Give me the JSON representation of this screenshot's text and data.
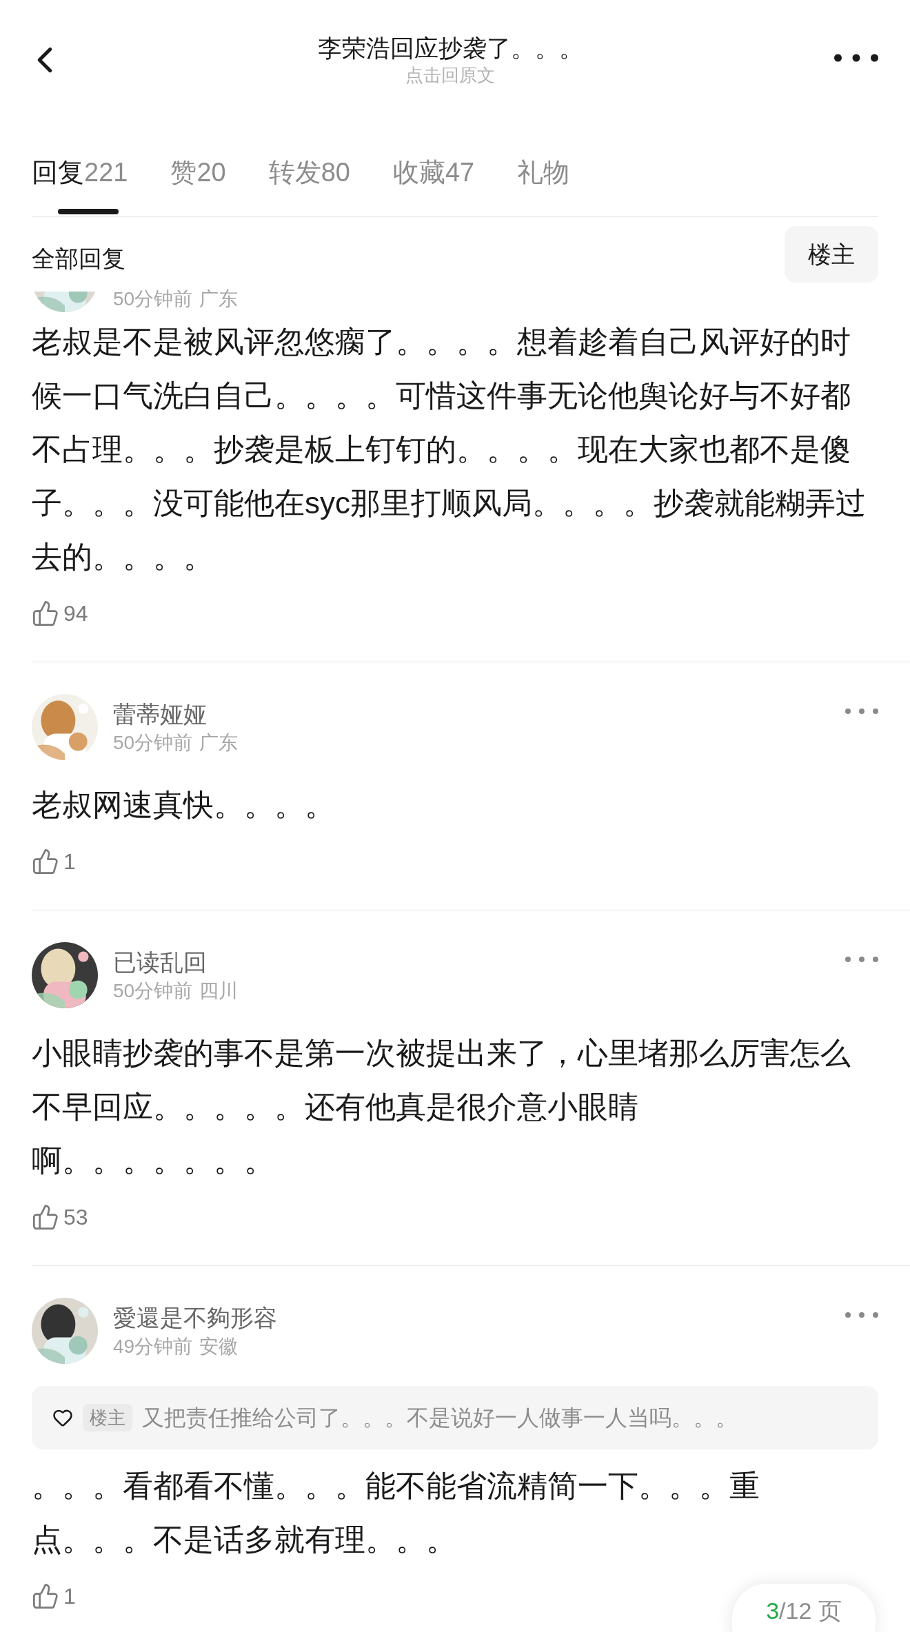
{
  "header": {
    "title": "李荣浩回应抄袭了。。。",
    "subtitle": "点击回原文"
  },
  "tabs": [
    {
      "label": "回复",
      "count": "221",
      "selected": true
    },
    {
      "label": "赞",
      "count": "20",
      "selected": false
    },
    {
      "label": "转发",
      "count": "80",
      "selected": false
    },
    {
      "label": "收藏",
      "count": "47",
      "selected": false
    },
    {
      "label": "礼物",
      "selected": false
    }
  ],
  "filter": {
    "label": "全部回复",
    "button": "楼主"
  },
  "comments": [
    {
      "time": "50分钟前",
      "location": "广东",
      "text": "老叔是不是被风评忽悠瘸了。。。。想着趁着自己风评好的时候一口气洗白自己。。。。可惜这件事无论他舆论好与不好都不占理。。。抄袭是板上钉钉的。。。。现在大家也都不是傻子。。。没可能他在syc那里打顺风局。。。。抄袭就能糊弄过去的。。。。",
      "likes": "94"
    },
    {
      "name": "蕾蒂娅娅",
      "time": "50分钟前",
      "location": "广东",
      "text": "老叔网速真快。。。。",
      "likes": "1"
    },
    {
      "name": "已读乱回",
      "time": "50分钟前",
      "location": "四川",
      "text": "小眼睛抄袭的事不是第一次被提出来了，心里堵那么厉害怎么不早回应。。。。。还有他真是很介意小眼睛啊。。。。。。。",
      "likes": "53"
    },
    {
      "name": "愛還是不夠形容",
      "time": "49分钟前",
      "location": "安徽",
      "quote": {
        "tag": "楼主",
        "text": "又把责任推给公司了。。。不是说好一人做事一人当吗。。。"
      },
      "text": "。。。看都看不懂。。。能不能省流精简一下。。。重点。。。不是话多就有理。。。",
      "likes": "1"
    }
  ],
  "pager": {
    "current": "3",
    "rest": "/12 页"
  }
}
